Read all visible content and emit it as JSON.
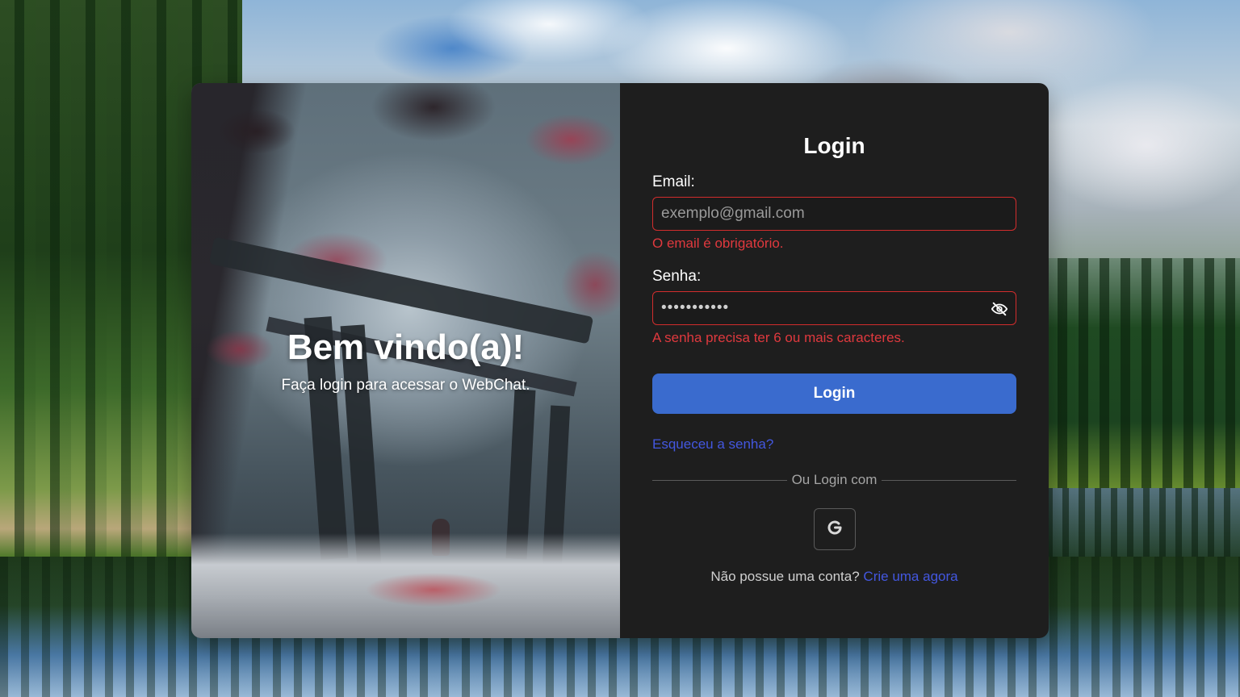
{
  "hero": {
    "title": "Bem vindo(a)!",
    "subtitle": "Faça login para acessar o WebChat."
  },
  "form": {
    "title": "Login",
    "email": {
      "label": "Email:",
      "placeholder": "exemplo@gmail.com",
      "value": "",
      "error": "O email é obrigatório."
    },
    "password": {
      "label": "Senha:",
      "value": "•••••••••••",
      "error": "A senha precisa ter 6 ou mais caracteres.",
      "toggle_icon": "eye-off-icon"
    },
    "submit_label": "Login",
    "forgot_label": "Esqueceu a senha?",
    "divider_label": "Ou Login com",
    "google_icon": "google-icon",
    "signup_prompt": "Não possue uma conta?",
    "signup_link": "Crie uma agora"
  },
  "colors": {
    "panel_bg": "#1e1e1e",
    "accent": "#3a6bce",
    "link": "#4357e0",
    "error": "#e0393e",
    "error_border": "#d22d2d"
  }
}
